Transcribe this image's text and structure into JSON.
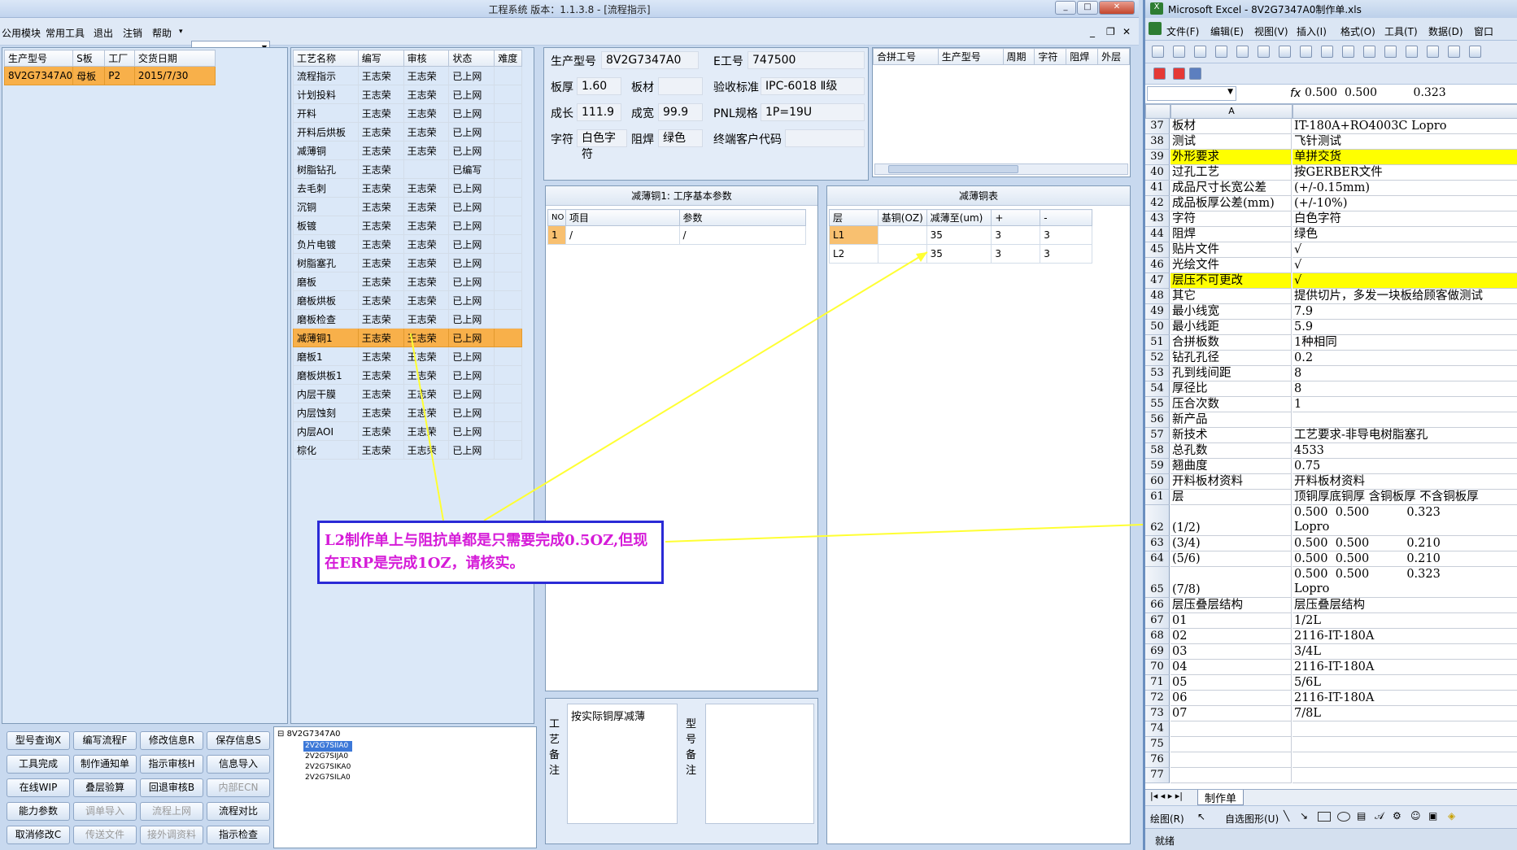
{
  "app": {
    "title": "工程系统   版本：1.1.3.8 - [流程指示]",
    "menu": [
      "公用模块",
      "常用工具",
      "退出",
      "注销",
      "帮助"
    ],
    "combo_value": ""
  },
  "left_grid": {
    "headers": [
      "生产型号",
      "S板",
      "工厂",
      "交货日期"
    ],
    "rows": [
      [
        "8V2G7347A0",
        "母板",
        "P2",
        "2015/7/30"
      ]
    ]
  },
  "process_grid": {
    "headers": [
      "工艺名称",
      "编写",
      "审核",
      "状态",
      "难度"
    ],
    "rows": [
      [
        "流程指示",
        "王志荣",
        "王志荣",
        "已上网",
        ""
      ],
      [
        "计划投料",
        "王志荣",
        "王志荣",
        "已上网",
        ""
      ],
      [
        "开料",
        "王志荣",
        "王志荣",
        "已上网",
        ""
      ],
      [
        "开料后烘板",
        "王志荣",
        "王志荣",
        "已上网",
        ""
      ],
      [
        "减薄铜",
        "王志荣",
        "王志荣",
        "已上网",
        ""
      ],
      [
        "树脂钻孔",
        "王志荣",
        "",
        "已编写",
        ""
      ],
      [
        "去毛刺",
        "王志荣",
        "王志荣",
        "已上网",
        ""
      ],
      [
        "沉铜",
        "王志荣",
        "王志荣",
        "已上网",
        ""
      ],
      [
        "板镀",
        "王志荣",
        "王志荣",
        "已上网",
        ""
      ],
      [
        "负片电镀",
        "王志荣",
        "王志荣",
        "已上网",
        ""
      ],
      [
        "树脂塞孔",
        "王志荣",
        "王志荣",
        "已上网",
        ""
      ],
      [
        "磨板",
        "王志荣",
        "王志荣",
        "已上网",
        ""
      ],
      [
        "磨板烘板",
        "王志荣",
        "王志荣",
        "已上网",
        ""
      ],
      [
        "磨板检查",
        "王志荣",
        "王志荣",
        "已上网",
        ""
      ],
      [
        "减薄铜1",
        "王志荣",
        "王志荣",
        "已上网",
        ""
      ],
      [
        "磨板1",
        "王志荣",
        "王志荣",
        "已上网",
        ""
      ],
      [
        "磨板烘板1",
        "王志荣",
        "王志荣",
        "已上网",
        ""
      ],
      [
        "内层干膜",
        "王志荣",
        "王志荣",
        "已上网",
        ""
      ],
      [
        "内层蚀刻",
        "王志荣",
        "王志荣",
        "已上网",
        ""
      ],
      [
        "内层AOI",
        "王志荣",
        "王志荣",
        "已上网",
        ""
      ],
      [
        "棕化",
        "王志荣",
        "王志荣",
        "已上网",
        ""
      ]
    ],
    "selected_index": 14
  },
  "info": {
    "model_label": "生产型号",
    "model": "8V2G7347A0",
    "eno_label": "E工号",
    "eno": "747500",
    "thick_label": "板厚",
    "thick": "1.60",
    "material_label": "板材",
    "material": "",
    "std_label": "验收标准",
    "std": "IPC-6018 Ⅱ级",
    "len_label": "成长",
    "len": "111.9",
    "wid_label": "成宽",
    "wid": "99.9",
    "pnl_label": "PNL规格",
    "pnl": "1P=19U",
    "char_label": "字符",
    "char": "白色字符",
    "mask_label": "阻焊",
    "mask": "绿色",
    "cust_label": "终端客户代码",
    "cust": ""
  },
  "merge_grid": {
    "headers": [
      "合拼工号",
      "生产型号",
      "周期",
      "字符",
      "阻焊",
      "外层"
    ]
  },
  "param_panel": {
    "title": "减薄铜1: 工序基本参数",
    "headers": [
      "NO",
      "项目",
      "参数"
    ],
    "rows": [
      [
        "1",
        "/",
        "/"
      ]
    ]
  },
  "cu_panel": {
    "title": "减薄铜表",
    "headers": [
      "层",
      "基铜(OZ)",
      "减薄至(um)",
      "+",
      "-"
    ],
    "rows": [
      [
        "L1",
        "",
        "35",
        "3",
        "3"
      ],
      [
        "L2",
        "",
        "35",
        "3",
        "3"
      ]
    ]
  },
  "remarks": {
    "craft_label": "工艺备注",
    "craft_text": "按实际铜厚减薄",
    "model_label": "型号备注",
    "model_text": ""
  },
  "buttons": [
    [
      "型号查询X",
      "编写流程F",
      "修改信息R",
      "保存信息S"
    ],
    [
      "工具完成",
      "制作通知单",
      "指示审核H",
      "信息导入"
    ],
    [
      "在线WIP",
      "叠层验算",
      "回退审核B",
      "内部ECN"
    ],
    [
      "能力参数",
      "调单导入",
      "流程上网",
      "流程对比"
    ],
    [
      "取消修改C",
      "传送文件",
      "接外调资料",
      "指示检查"
    ]
  ],
  "tree": {
    "root": "8V2G7347A0",
    "children": [
      "2V2G7SIIA0",
      "2V2G7SIJA0",
      "2V2G7SIKA0",
      "2V2G7SILA0"
    ],
    "selected_index": 0
  },
  "callout": {
    "text": "L2制作单上与阻抗单都是只需要完成0.5OZ,但现在ERP是完成1OZ，请核实。"
  },
  "excel": {
    "title": "Microsoft Excel - 8V2G7347A0制作单.xls",
    "menu": [
      "文件(F)",
      "编辑(E)",
      "视图(V)",
      "插入(I)",
      "格式(O)",
      "工具(T)",
      "数据(D)",
      "窗口"
    ],
    "formula": "0.500  0.500          0.323",
    "col_a": "A",
    "rows": [
      {
        "n": "37",
        "a": "板材",
        "b": "IT-180A+RO4003C Lopro",
        "hl": false
      },
      {
        "n": "38",
        "a": "测试",
        "b": "飞针测试",
        "hl": false
      },
      {
        "n": "39",
        "a": "外形要求",
        "b": "单拼交货",
        "hl": true
      },
      {
        "n": "40",
        "a": "过孔工艺",
        "b": "按GERBER文件",
        "hl": false
      },
      {
        "n": "41",
        "a": "成品尺寸长宽公差",
        "b": "(+/-0.15mm)",
        "hl": false
      },
      {
        "n": "42",
        "a": "成品板厚公差(mm)",
        "b": "(+/-10%)",
        "hl": false
      },
      {
        "n": "43",
        "a": "字符",
        "b": "白色字符",
        "hl": false
      },
      {
        "n": "44",
        "a": "阻焊",
        "b": "绿色",
        "hl": false
      },
      {
        "n": "45",
        "a": "贴片文件",
        "b": "√",
        "hl": false
      },
      {
        "n": "46",
        "a": "光绘文件",
        "b": "√",
        "hl": false
      },
      {
        "n": "47",
        "a": "层压不可更改",
        "b": "√",
        "hl": true
      },
      {
        "n": "48",
        "a": "其它",
        "b": "提供切片，多发一块板给顾客做测试",
        "hl": false
      },
      {
        "n": "49",
        "a": "最小线宽",
        "b": "7.9",
        "hl": false
      },
      {
        "n": "50",
        "a": "最小线距",
        "b": "5.9",
        "hl": false
      },
      {
        "n": "51",
        "a": "合拼板数",
        "b": "1种相同",
        "hl": false
      },
      {
        "n": "52",
        "a": "钻孔孔径",
        "b": "0.2",
        "hl": false
      },
      {
        "n": "53",
        "a": "孔到线间距",
        "b": "8",
        "hl": false
      },
      {
        "n": "54",
        "a": "厚径比",
        "b": "8",
        "hl": false
      },
      {
        "n": "55",
        "a": "压合次数",
        "b": "1",
        "hl": false
      },
      {
        "n": "56",
        "a": "新产品",
        "b": "",
        "hl": false
      },
      {
        "n": "57",
        "a": "新技术",
        "b": "工艺要求-非导电树脂塞孔",
        "hl": false
      },
      {
        "n": "58",
        "a": "总孔数",
        "b": "4533",
        "hl": false
      },
      {
        "n": "59",
        "a": "翘曲度",
        "b": "0.75",
        "hl": false
      },
      {
        "n": "60",
        "a": "开料板材资料",
        "b": "开料板材资料",
        "hl": false
      },
      {
        "n": "61",
        "a": "层",
        "b": "顶铜厚底铜厚 含铜板厚 不含铜板厚",
        "hl": false
      },
      {
        "n": "62",
        "a": "(1/2)",
        "b": "0.500  0.500          0.323",
        "b2": "Lopro",
        "tall": true,
        "hl": false
      },
      {
        "n": "63",
        "a": "(3/4)",
        "b": "0.500  0.500          0.210",
        "hl": false
      },
      {
        "n": "64",
        "a": "(5/6)",
        "b": "0.500  0.500          0.210",
        "hl": false
      },
      {
        "n": "65",
        "a": "(7/8)",
        "b": "0.500  0.500          0.323",
        "b2": "Lopro",
        "tall": true,
        "hl": false
      },
      {
        "n": "66",
        "a": "层压叠层结构",
        "b": "层压叠层结构",
        "hl": false
      },
      {
        "n": "67",
        "a": "01",
        "b": "1/2L",
        "hl": false
      },
      {
        "n": "68",
        "a": "02",
        "b": "2116-IT-180A",
        "hl": false
      },
      {
        "n": "69",
        "a": "03",
        "b": "3/4L",
        "hl": false
      },
      {
        "n": "70",
        "a": "04",
        "b": "2116-IT-180A",
        "hl": false
      },
      {
        "n": "71",
        "a": "05",
        "b": "5/6L",
        "hl": false
      },
      {
        "n": "72",
        "a": "06",
        "b": "2116-IT-180A",
        "hl": false
      },
      {
        "n": "73",
        "a": "07",
        "b": "7/8L",
        "hl": false
      },
      {
        "n": "74",
        "a": "",
        "b": "",
        "hl": false
      },
      {
        "n": "75",
        "a": "",
        "b": "",
        "hl": false
      },
      {
        "n": "76",
        "a": "",
        "b": "",
        "hl": false
      },
      {
        "n": "77",
        "a": "",
        "b": "",
        "hl": false
      }
    ],
    "sheet_tab": "制作单",
    "draw_label": "绘图(R)",
    "autoshape_label": "自选图形(U)",
    "status": "就绪"
  }
}
